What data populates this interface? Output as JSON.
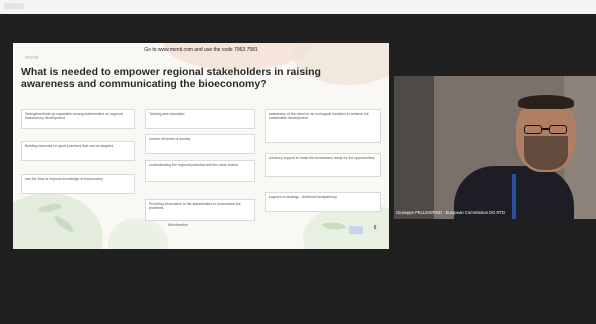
{
  "slide": {
    "instruction": "Go to www.menti.com and use the code 7963 7581",
    "brand": "menti",
    "question": "What is needed to empower regional stakeholders in raising awareness and communicating the bioeconomy?",
    "responses": [
      "Strengthen/build up capacities among stakeholders on regional bioeconomy development",
      "Building networks for good practices that can be adapted",
      "use the Bios to improve knowledge of bioeconomy",
      "Training and education",
      "Involve all levels of society",
      "understanding the regional potential and the value chains",
      "Providing information to the stakeholders to understand the problems",
      "awareness of the need for an ecological transition to achieve full sustainable development",
      "Advisory support to make the businesses ready for the opportunities",
      "support on strategy - territorial transparency"
    ],
    "footer": "Mentimeter",
    "response_count": "8"
  },
  "video": {
    "participant_name": "Giuseppe PELLEGRINO · European Commission DG RTD"
  }
}
